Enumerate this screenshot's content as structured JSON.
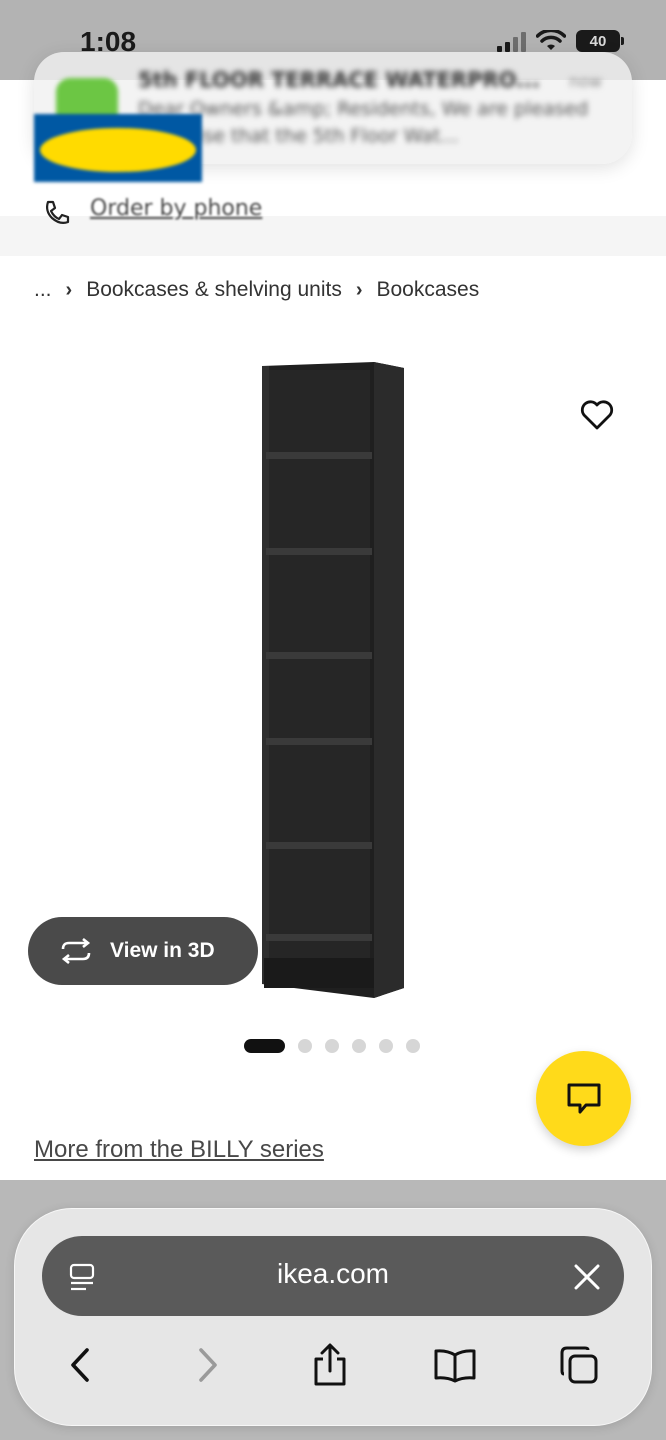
{
  "status_bar": {
    "time": "1:08",
    "battery": "40"
  },
  "header": {
    "logo_icon": "ikea-logo",
    "phone_icon": "phone-icon",
    "order_by_phone": "Order by phone"
  },
  "notification": {
    "app_icon": "notes-app-icon",
    "title": "5th FLOOR TERRACE WATERPRO...",
    "time": "now",
    "body": "Dear Owners &amp; Residents, We are pleased to advise that the 5th Floor Wat..."
  },
  "breadcrumb": {
    "items": [
      "...",
      "Bookcases & shelving units",
      "Bookcases"
    ],
    "separator_icon": "chevron-right-icon"
  },
  "product": {
    "image_icon": "bookcase-product-image",
    "wishlist_icon": "heart-icon",
    "view_3d_label": "View in 3D",
    "view_3d_icon": "rotate-3d-icon",
    "carousel_total": 6,
    "carousel_active": 1,
    "series_link": "More from the BILLY series"
  },
  "chat": {
    "icon": "chat-bubble-icon",
    "color": "#ffda1a"
  },
  "browser": {
    "url": "ikea.com",
    "reader_icon": "reader-mode-icon",
    "close_icon": "close-icon",
    "nav": [
      "back-icon",
      "forward-icon",
      "share-icon",
      "bookmarks-icon",
      "tabs-icon"
    ]
  }
}
